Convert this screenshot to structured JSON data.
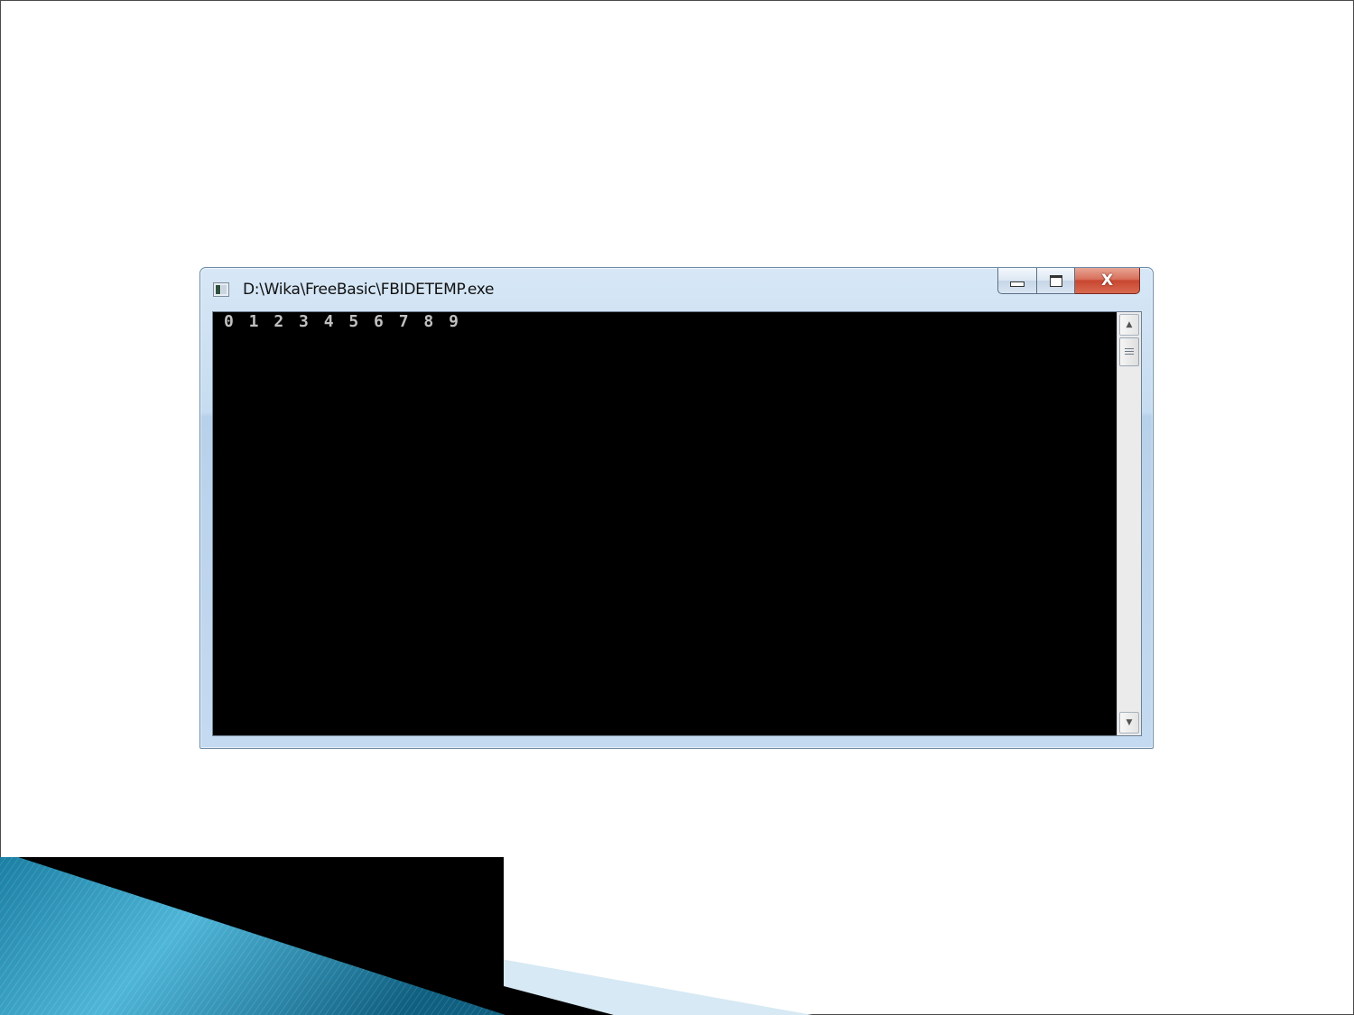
{
  "window": {
    "title": "D:\\Wika\\FreeBasic\\FBIDETEMP.exe",
    "icon": "console-app-icon",
    "buttons": {
      "minimize": "minimize-icon",
      "maximize": "maximize-icon",
      "close": "X"
    }
  },
  "console": {
    "output": "0 1 2 3 4 5 6 7 8 9",
    "background": "#000000",
    "foreground": "#c0c0c0"
  },
  "scrollbar": {
    "up_icon": "▲",
    "down_icon": "▼"
  },
  "colors": {
    "accent_teal": "#1f8fb4",
    "frame": "#c4daf0",
    "close": "#c84630"
  }
}
